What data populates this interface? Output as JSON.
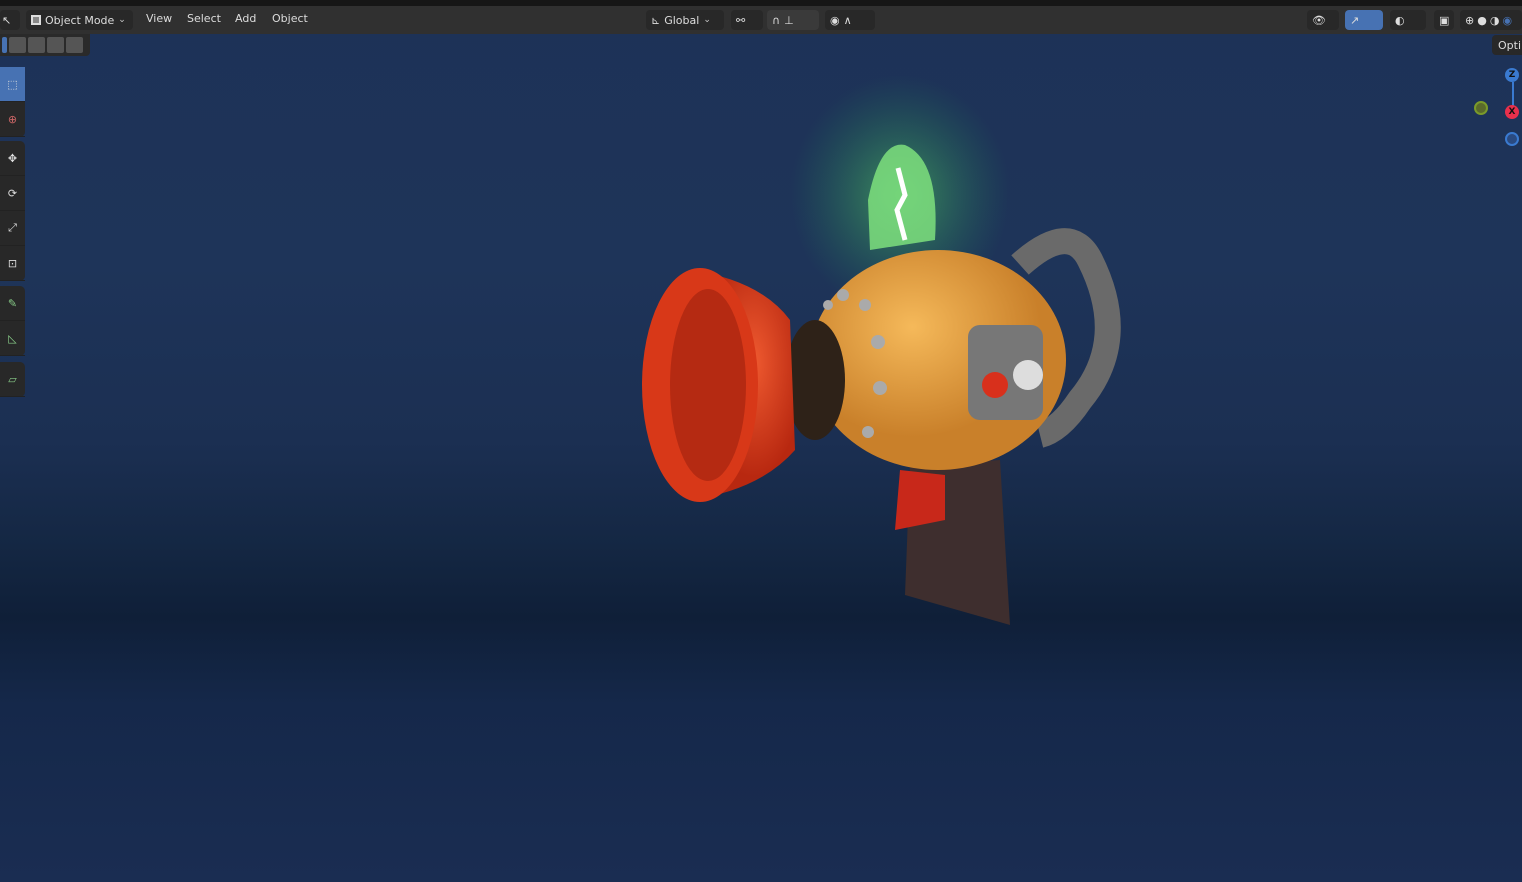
{
  "header": {
    "mode": "Object Mode",
    "menus": [
      "View",
      "Select",
      "Add",
      "Object"
    ],
    "transform_orientation": "Global",
    "options_label": "Opti"
  },
  "gizmo": {
    "z_label": "Z",
    "x_label": "X"
  },
  "colors": {
    "accent": "#4772b3",
    "header": "#303030",
    "viewport": "#1d3257"
  }
}
